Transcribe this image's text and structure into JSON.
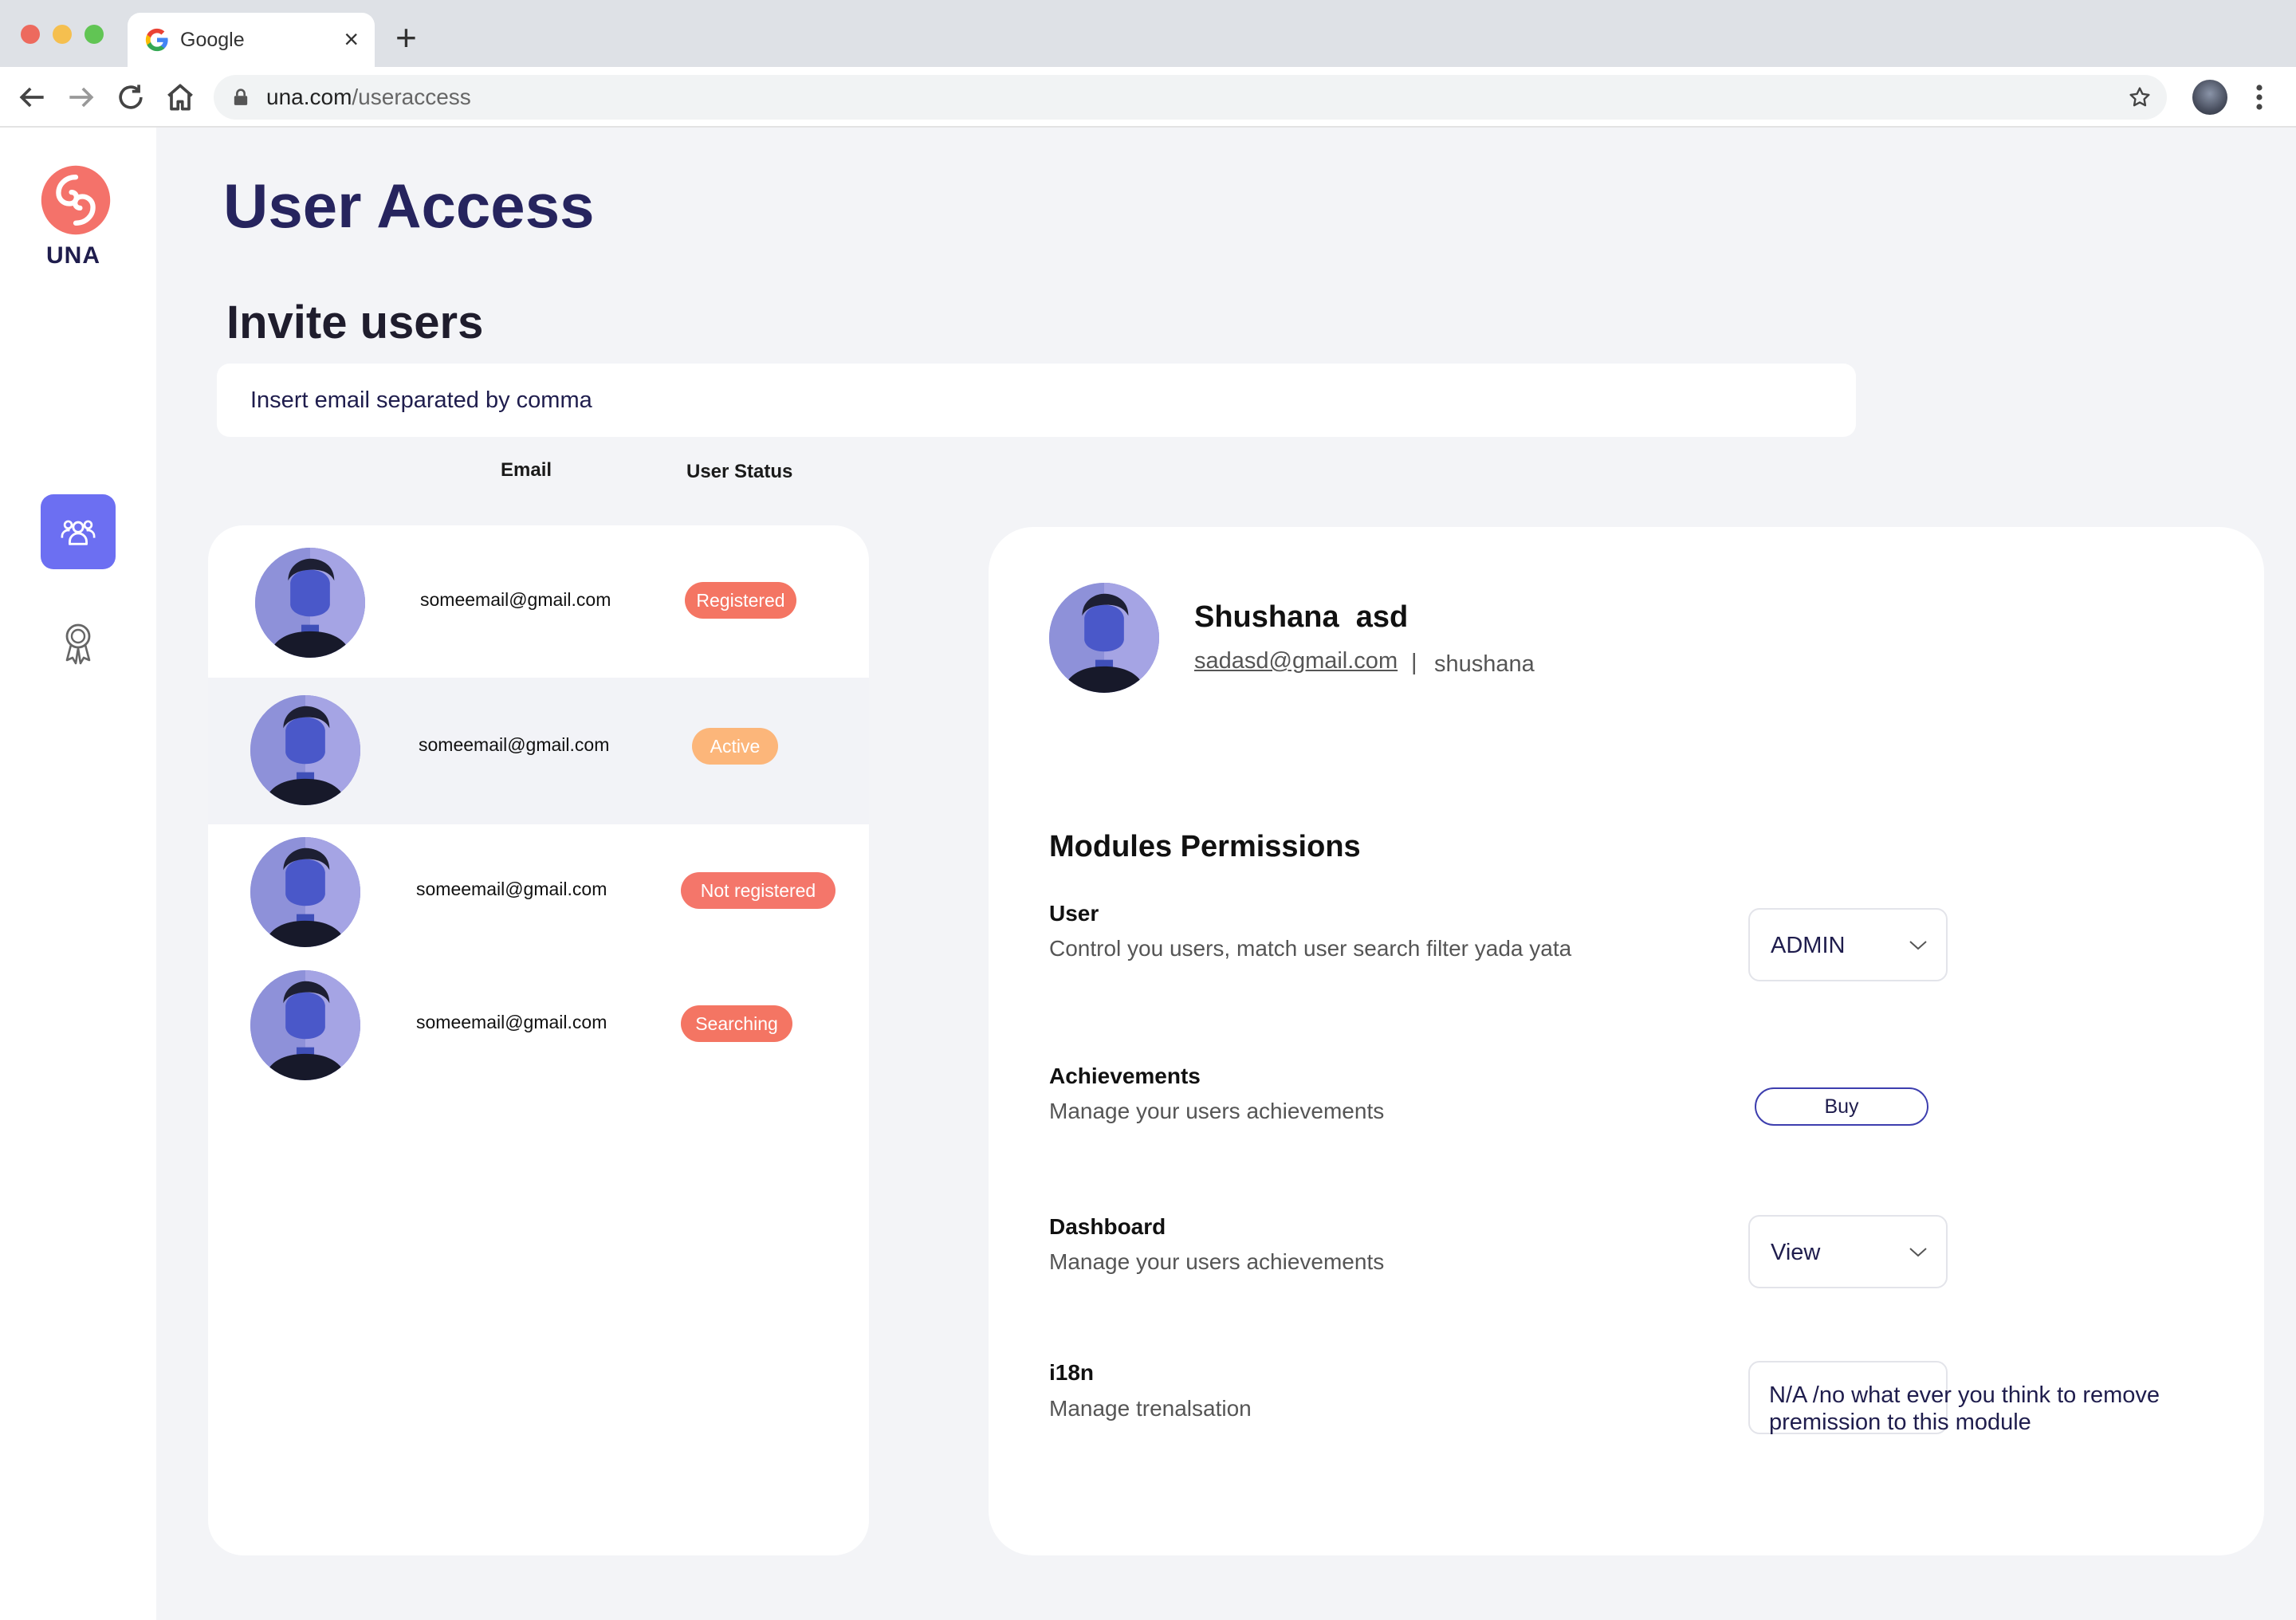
{
  "browser": {
    "tab_title": "Google",
    "tab_close": "×",
    "new_tab": "+",
    "url_domain": "una.com",
    "url_path": "/useraccess"
  },
  "sidebar": {
    "logo_text": "UNA",
    "items": [
      {
        "name": "users",
        "icon": "users-icon",
        "active": true
      },
      {
        "name": "achievements",
        "icon": "award-icon",
        "active": false
      }
    ],
    "accent_color": "#6c6ff2"
  },
  "page": {
    "title": "User Access",
    "invite_title": "Invite users",
    "invite_placeholder": "Insert email separated by comma"
  },
  "table": {
    "headers": [
      "Email",
      "User Status"
    ],
    "rows": [
      {
        "email": "someemail@gmail.com",
        "status": "Registered",
        "status_color": "#f47563"
      },
      {
        "email": "someemail@gmail.com",
        "status": "Active",
        "status_color": "#fcb67a",
        "selected": true
      },
      {
        "email": "someemail@gmail.com",
        "status": "Not registered",
        "status_color": "#f4766a"
      },
      {
        "email": "someemail@gmail.com",
        "status": "Searching",
        "status_color": "#f47563"
      }
    ]
  },
  "detail": {
    "name": "Shushana  asd",
    "email": "sadasd@gmail.com",
    "separator": "|",
    "username": "shushana",
    "permissions_title": "Modules Permissions",
    "modules": [
      {
        "name": "User",
        "description": "Control you users, match user search filter yada yata",
        "control": "select",
        "value": "ADMIN"
      },
      {
        "name": "Achievements",
        "description": "Manage your users achievements",
        "control": "button",
        "value": "Buy"
      },
      {
        "name": "Dashboard",
        "description": "Manage your users achievements",
        "control": "select",
        "value": "View"
      },
      {
        "name": "i18n",
        "description": "Manage trenalsation",
        "control": "select",
        "value": "N/A /no what ever you think to remove\n premission to this module"
      }
    ]
  }
}
